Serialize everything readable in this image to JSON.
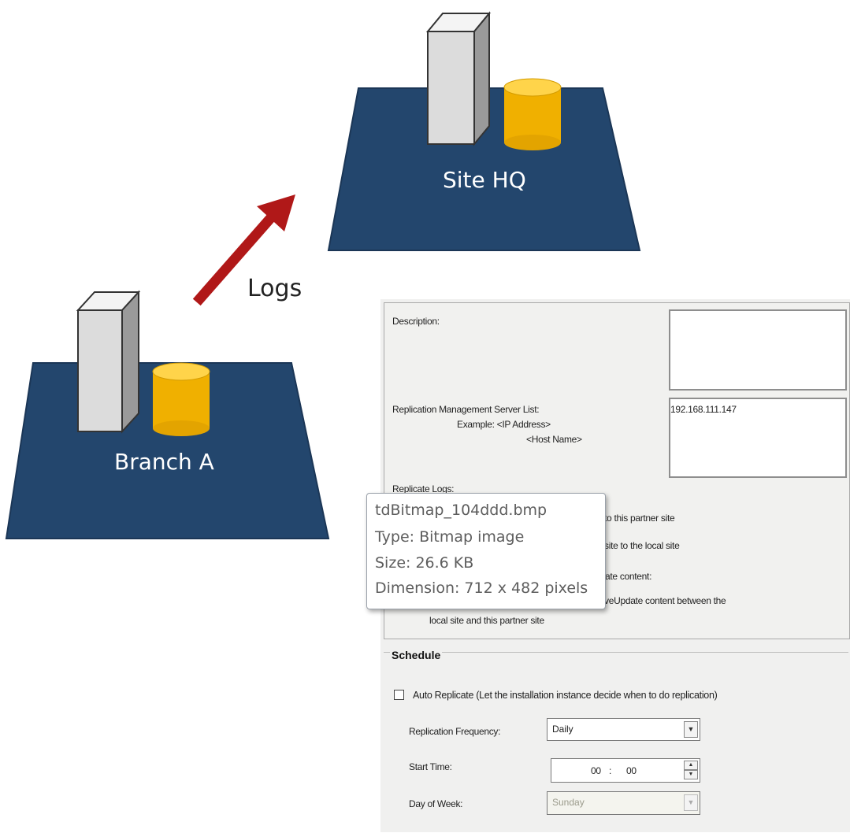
{
  "diagram": {
    "hq_label": "Site HQ",
    "branch_label": "Branch A",
    "arrow_label": "Logs",
    "colors": {
      "platform": "#23466d",
      "server": "#e4e4e4",
      "database": "#f2b600",
      "arrow": "#b01818"
    }
  },
  "panel": {
    "description_label": "Description:",
    "description_value": "",
    "server_list_label": "Replication Management Server List:",
    "example_label": "Example: <IP Address>",
    "host_name_label": "<Host Name>",
    "server_list_value": "192.168.111.147",
    "replicate_logs_label": "Replicate Logs:",
    "option_1_fragment": "to this partner site",
    "option_2_fragment": "site to the local site",
    "option_3_fragment": "ate content:",
    "option_4_fragment": "veUpdate content between the",
    "option_4_line2": "local site and this partner site"
  },
  "schedule": {
    "title": "Schedule",
    "auto_replicate_label": "Auto Replicate (Let the installation instance decide when to do replication)",
    "auto_replicate_checked": false,
    "frequency_label": "Replication Frequency:",
    "frequency_value": "Daily",
    "start_time_label": "Start Time:",
    "start_time_hour": "00",
    "start_time_minute": "00",
    "time_separator": ":",
    "day_label": "Day of Week:",
    "day_value": "Sunday"
  },
  "tooltip": {
    "filename": "tdBitmap_104ddd.bmp",
    "type": "Type: Bitmap image",
    "size": "Size: 26.6 KB",
    "dimension": "Dimension: 712 x 482 pixels"
  }
}
